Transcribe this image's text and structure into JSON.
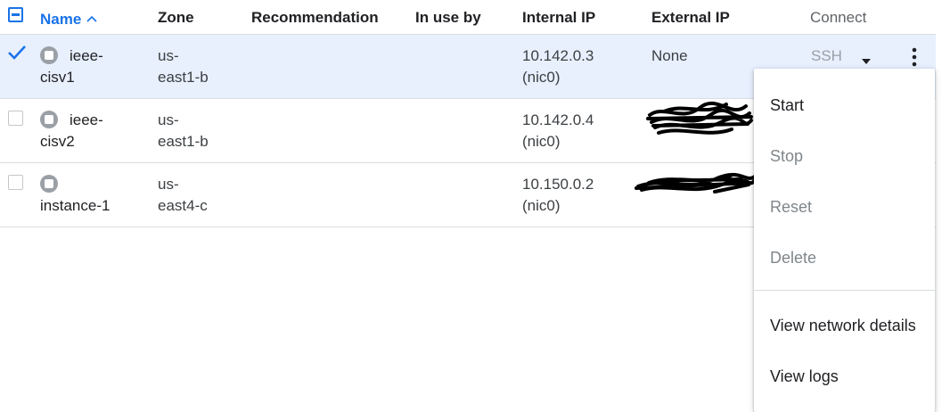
{
  "header": {
    "name": "Name",
    "zone": "Zone",
    "recommendation": "Recommendation",
    "in_use_by": "In use by",
    "internal_ip": "Internal IP",
    "external_ip": "External IP",
    "connect": "Connect",
    "sort_icon": "arrow-up-icon"
  },
  "rows": [
    {
      "name_line1": "ieee-",
      "name_line2": "cisv1",
      "zone_line1": "us-",
      "zone_line2": "east1-b",
      "internal_ip_line1": "10.142.0.3",
      "internal_ip_line2": "(nic0)",
      "external_ip": "None",
      "connect": "SSH",
      "selected": true,
      "status_icon": "stopped-icon"
    },
    {
      "name_line1": "ieee-",
      "name_line2": "cisv2",
      "zone_line1": "us-",
      "zone_line2": "east1-b",
      "internal_ip_line1": "10.142.0.4",
      "internal_ip_line2": "(nic0)",
      "external_ip": "",
      "selected": false,
      "status_icon": "stopped-icon"
    },
    {
      "name_line1": "",
      "name_line2": "instance-1",
      "zone_line1": "us-",
      "zone_line2": "east4-c",
      "internal_ip_line1": "10.150.0.2",
      "internal_ip_line2": "(nic0)",
      "external_ip": "",
      "selected": false,
      "status_icon": "stopped-icon"
    }
  ],
  "menu": {
    "start": "Start",
    "stop": "Stop",
    "reset": "Reset",
    "delete": "Delete",
    "view_network_details": "View network details",
    "view_logs": "View logs"
  },
  "colors": {
    "accent": "#1a73e8",
    "selected_row": "#e8f0fe",
    "status_grey": "#9aa0a6"
  }
}
